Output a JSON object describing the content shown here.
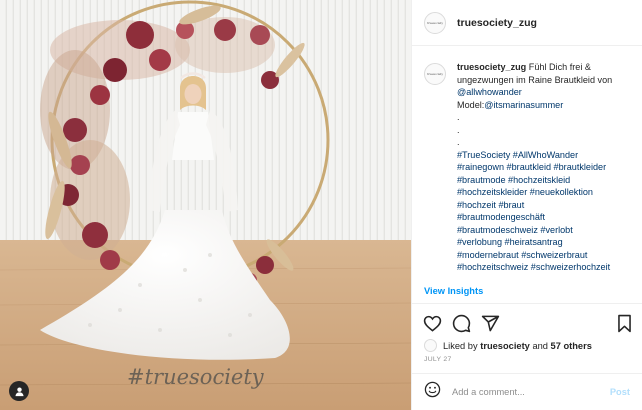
{
  "post": {
    "username": "truesociety_zug",
    "avatar_text": "truesociety",
    "photo_watermark": "#truesociety"
  },
  "caption": {
    "username": "truesociety_zug",
    "text": "Fühl Dich frei & ungezwungen im Raine Brautkleid von",
    "mention": "@allwhowander",
    "model_label": "Model:",
    "model_mention": "@itsmarinasummer",
    "dots": [
      ".",
      ".",
      "."
    ],
    "hashtag_lines": [
      "#TrueSociety #AllWhoWander",
      "#rainegown #brautkleid #brautkleider",
      "#brautmode #hochzeitskleid",
      "#hochzeitskleider #neuekollektion",
      "#hochzeit #braut",
      "#brautmodengeschäft",
      "#brautmodeschweiz #verlobt",
      "#verlobung #heiratsantrag",
      "#modernebraut #schweizerbraut",
      "#hochzeitschweiz #schweizerhochzeit"
    ]
  },
  "insights_label": "View Insights",
  "likes": {
    "prefix": "Liked by",
    "user": "truesociety",
    "and": "and",
    "others": "57 others"
  },
  "date": "JULY 27",
  "comment": {
    "placeholder": "Add a comment...",
    "post_label": "Post"
  },
  "icons": {
    "like": "heart-icon",
    "comment": "comment-icon",
    "share": "share-icon",
    "save": "bookmark-icon",
    "emoji": "emoji-icon",
    "tag": "user-tag-icon"
  },
  "colors": {
    "link": "#00376b",
    "insights": "#0095f6",
    "post_disabled": "#b2dffc",
    "muted": "#8e8e8e"
  }
}
